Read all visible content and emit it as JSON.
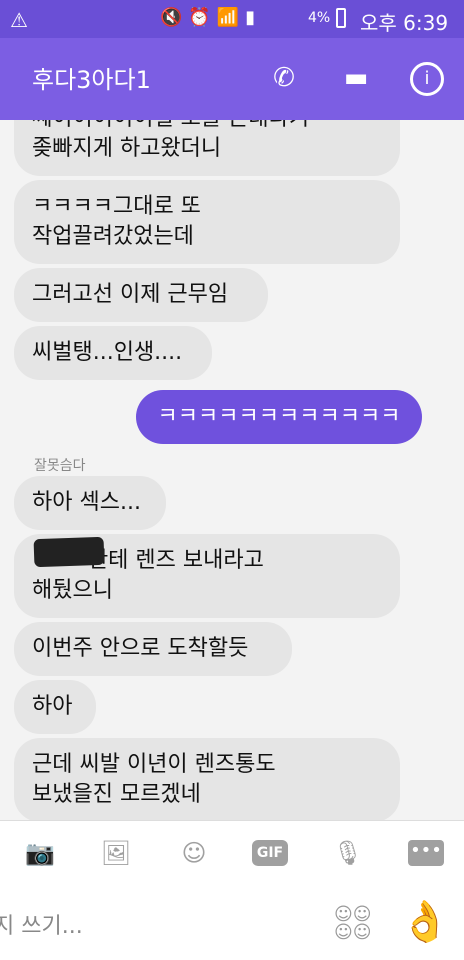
{
  "status": {
    "battery": "4%",
    "time": "오후 6:39"
  },
  "header": {
    "title": "후다3아다1"
  },
  "messages": {
    "m1": "쎄이이이이이일 모블 큰대다기\n좆빠지게 하고왔더니",
    "m2": "ㅋㅋㅋㅋ그대로 또\n작업끌려갔었는데",
    "m3": "그러고선 이제 근무임",
    "m4": "씨벌탱...인생....",
    "me1": "ㅋㅋㅋㅋㅋㅋㅋㅋㅋㅋㅋㅋ",
    "sender": "잘못슴다",
    "m5": "하아 섹스...",
    "m6": "        한테 렌즈 보내라고\n해뒀으니",
    "m7": "이번주 안으로 도착할듯",
    "m8": "하아",
    "m9": "근데 씨발 이년이 렌즈통도\n보냈을진 모르겠네"
  },
  "composer": {
    "placeholder": "지 쓰기..."
  },
  "icons": {
    "camera": "camera-icon",
    "image": "image-icon",
    "emoji": "emoji-icon",
    "gif": "GIF",
    "mic": "mic-icon",
    "more": "more-icon",
    "like": "ok-hand-icon"
  },
  "colors": {
    "appbar": "#7c5ee3",
    "statusbar": "#6a4fd6",
    "outgoing": "#6f51dd",
    "incoming": "#e5e5e5"
  }
}
